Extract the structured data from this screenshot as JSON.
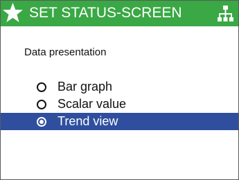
{
  "header": {
    "title": "SET STATUS-SCREEN",
    "background": "#3aa845",
    "left_icon": "star-icon",
    "right_icon": "network-icon"
  },
  "main": {
    "section_label": "Data presentation",
    "selected_background": "#2f4f9e",
    "options": [
      {
        "label": "Bar graph",
        "selected": false
      },
      {
        "label": "Scalar value",
        "selected": false
      },
      {
        "label": "Trend view",
        "selected": true
      }
    ]
  }
}
